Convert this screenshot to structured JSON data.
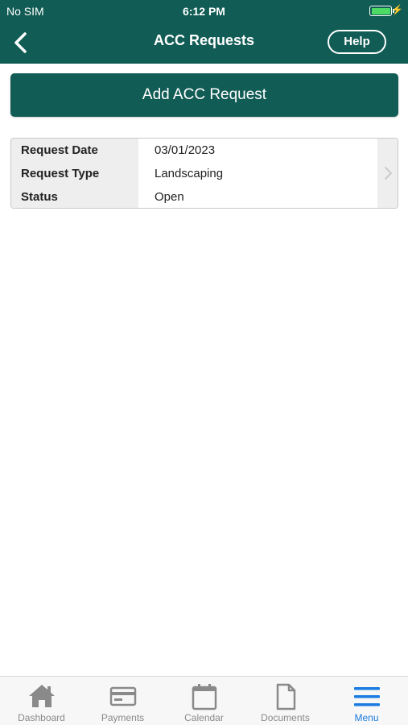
{
  "status_bar": {
    "carrier": "No SIM",
    "time": "6:12 PM"
  },
  "nav": {
    "title": "ACC Requests",
    "help_label": "Help"
  },
  "add_button_label": "Add ACC Request",
  "request": [
    {
      "label": "Request Date",
      "value": "03/01/2023"
    },
    {
      "label": "Request Type",
      "value": "Landscaping"
    },
    {
      "label": "Status",
      "value": "Open"
    }
  ],
  "tabs": [
    {
      "label": "Dashboard",
      "icon": "home-icon"
    },
    {
      "label": "Payments",
      "icon": "credit-card-icon"
    },
    {
      "label": "Calendar",
      "icon": "calendar-icon"
    },
    {
      "label": "Documents",
      "icon": "document-icon"
    },
    {
      "label": "Menu",
      "icon": "menu-icon"
    }
  ],
  "colors": {
    "brand": "#115c55",
    "active_tab": "#1a7be0",
    "battery": "#4cd964"
  }
}
